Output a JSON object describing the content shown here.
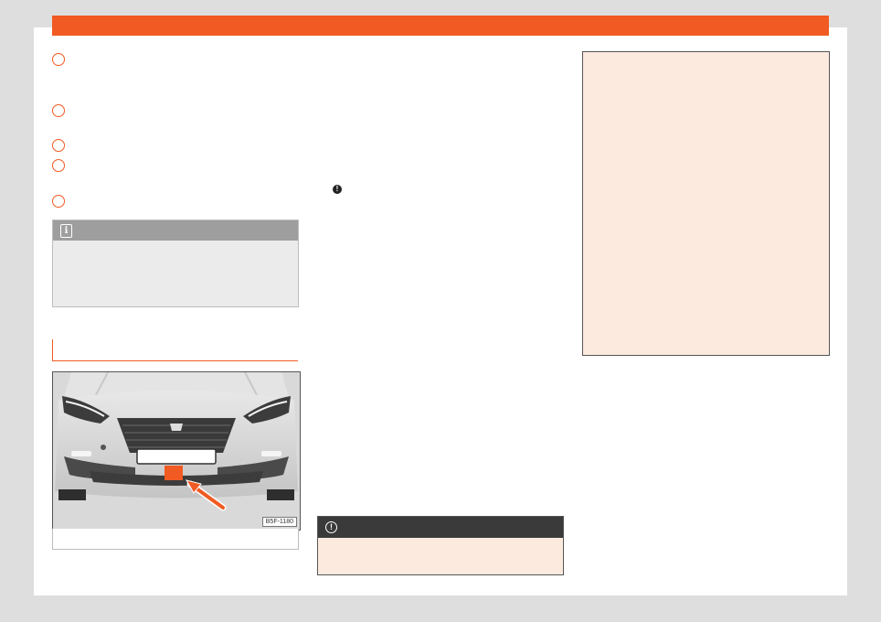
{
  "colors": {
    "accent": "#f15a22",
    "note_gray": "#9e9e9e",
    "caution_dark": "#3a3a3a",
    "warning_tint": "#fdeadf"
  },
  "steps": {
    "count": 5
  },
  "note": {
    "icon": "info-icon"
  },
  "attention": {
    "icon": "exclamation-icon"
  },
  "caution": {
    "icon": "exclamation-circle-icon"
  },
  "figure": {
    "code": "B5F-1180",
    "brand_emblem": "SEAT",
    "highlight": "front-towing-eye-cover",
    "arrow": "arrow-pointer-icon"
  }
}
